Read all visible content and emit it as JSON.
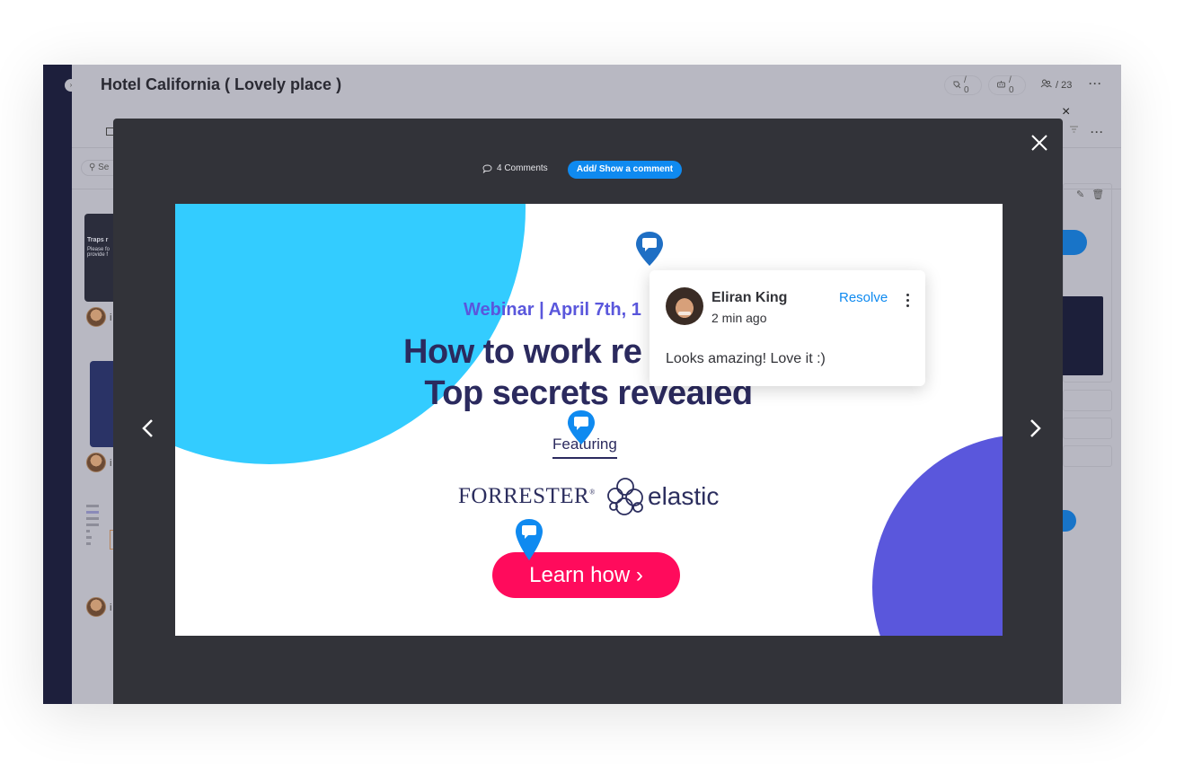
{
  "board": {
    "title": "Hotel California ( Lovely place )",
    "header_badges": [
      {
        "icon": "integrations-icon",
        "value": "/ 0"
      },
      {
        "icon": "automations-icon",
        "value": "/ 0"
      }
    ],
    "members": {
      "icon": "members-icon",
      "value": "/ 23"
    },
    "more_label": "···",
    "search_placeholder": "Se",
    "card_title_partial": "Traps r",
    "card_body_partial": "Please fo provide f",
    "avatar_label_partial": "i",
    "close_label": "×"
  },
  "viewer": {
    "comments_count_label": "4 Comments",
    "add_comment_label": "Add/ Show a comment",
    "colors": {
      "accent": "#0f8af0",
      "modal_bg": "#323339",
      "pin": "#0f8af0",
      "pin_active": "#1f6fc4"
    }
  },
  "slide": {
    "kicker": "Webinar | April 7th, 1",
    "headline_line1": "How to work re",
    "headline_line2": "Top secrets revealed",
    "featuring": "Featuring",
    "logo_forrester": "FORRESTER",
    "logo_forrester_reg": "®",
    "logo_elastic": "elastic",
    "cta": "Learn how ›",
    "colors": {
      "cyan": "#33ccff",
      "purple": "#5a57dc",
      "navy": "#2b2a5e",
      "cta": "#ff0b5c"
    }
  },
  "comment": {
    "author": "Eliran King",
    "time": "2 min ago",
    "resolve_label": "Resolve",
    "body": "Looks amazing! Love it :)"
  }
}
